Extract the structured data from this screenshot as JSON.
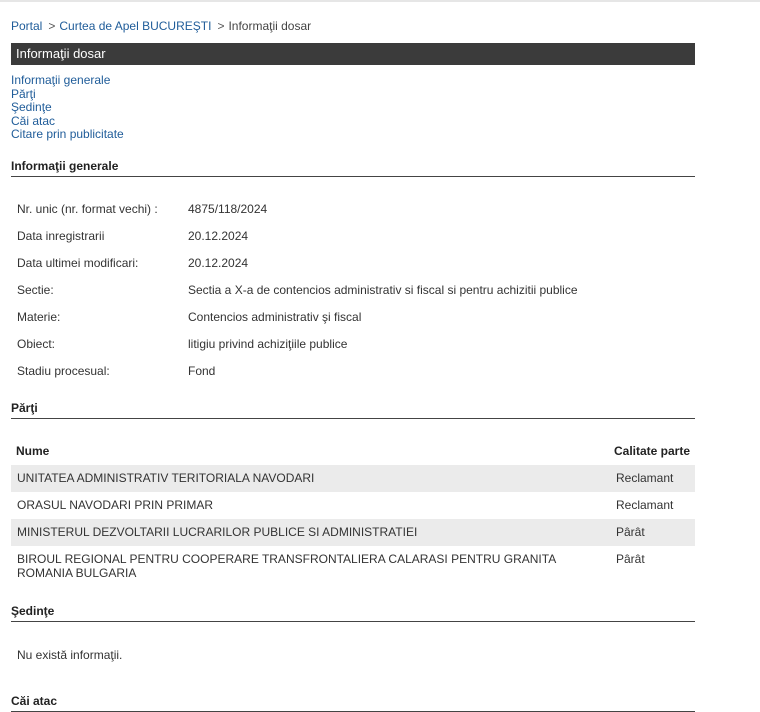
{
  "breadcrumb": {
    "portal": "Portal",
    "court": "Curtea de Apel BUCUREŞTI",
    "current": "Informaţii dosar",
    "sep": ">"
  },
  "header_bar": {
    "title": "Informaţii dosar"
  },
  "nav_links": [
    "Informaţii generale",
    "Părţi",
    "Şedinţe",
    "Căi atac",
    "Citare prin publicitate"
  ],
  "sections": {
    "general": "Informaţii generale",
    "parties": "Părţi",
    "hearings": "Şedinţe",
    "appeals": "Căi atac"
  },
  "general_info": [
    {
      "label": "Nr. unic (nr. format vechi) :",
      "value": "4875/118/2024"
    },
    {
      "label": "Data inregistrarii",
      "value": "20.12.2024"
    },
    {
      "label": "Data ultimei modificari:",
      "value": "20.12.2024"
    },
    {
      "label": "Sectie:",
      "value": "Sectia a X-a de contencios administrativ si fiscal si pentru achizitii publice"
    },
    {
      "label": "Materie:",
      "value": "Contencios administrativ şi fiscal"
    },
    {
      "label": "Obiect:",
      "value": "litigiu privind achiziţiile publice"
    },
    {
      "label": "Stadiu procesual:",
      "value": "Fond"
    }
  ],
  "parties_table": {
    "headers": {
      "name": "Nume",
      "role": "Calitate parte"
    },
    "rows": [
      {
        "name": "UNITATEA ADMINISTRATIV TERITORIALA NAVODARI",
        "role": "Reclamant"
      },
      {
        "name": "ORASUL NAVODARI PRIN PRIMAR",
        "role": "Reclamant"
      },
      {
        "name": "MINISTERUL DEZVOLTARII LUCRARILOR PUBLICE SI ADMINISTRATIEI",
        "role": "Pârât"
      },
      {
        "name": "BIROUL REGIONAL PENTRU COOPERARE TRANSFRONTALIERA CALARASI PENTRU GRANITA ROMANIA BULGARIA",
        "role": "Pârât"
      }
    ]
  },
  "hearings": {
    "empty_text": "Nu există informaţii."
  }
}
